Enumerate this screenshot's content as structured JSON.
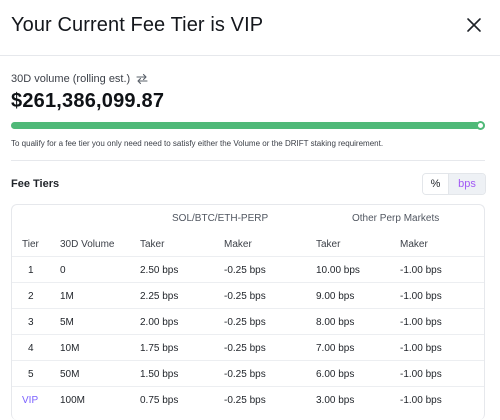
{
  "modal": {
    "title": "Your Current Fee Tier is VIP",
    "close_icon": "close-icon"
  },
  "volume": {
    "label": "30D volume (rolling est.)",
    "toggle_icon": "swap-arrows-icon",
    "value": "$261,386,099.87",
    "progress_fraction": 0.99,
    "progress_color": "#4fb978"
  },
  "note": "To qualify for a fee tier you only need need to satisfy either the Volume or the DRIFT staking requirement.",
  "fee_tiers": {
    "title": "Fee Tiers",
    "unit_options": [
      "%",
      "bps"
    ],
    "selected_unit": "bps",
    "accent_color": "#a259f5",
    "groups": [
      "SOL/BTC/ETH-PERP",
      "Other Perp Markets"
    ],
    "columns": [
      "Tier",
      "30D Volume",
      "Taker",
      "Maker",
      "Taker",
      "Maker"
    ],
    "rows": [
      [
        "1",
        "0",
        "2.50 bps",
        "-0.25 bps",
        "10.00 bps",
        "-1.00 bps"
      ],
      [
        "2",
        "1M",
        "2.25 bps",
        "-0.25 bps",
        "9.00 bps",
        "-1.00 bps"
      ],
      [
        "3",
        "5M",
        "2.00 bps",
        "-0.25 bps",
        "8.00 bps",
        "-1.00 bps"
      ],
      [
        "4",
        "10M",
        "1.75 bps",
        "-0.25 bps",
        "7.00 bps",
        "-1.00 bps"
      ],
      [
        "5",
        "50M",
        "1.50 bps",
        "-0.25 bps",
        "6.00 bps",
        "-1.00 bps"
      ],
      [
        "VIP",
        "100M",
        "0.75 bps",
        "-0.25 bps",
        "3.00 bps",
        "-1.00 bps"
      ]
    ]
  }
}
